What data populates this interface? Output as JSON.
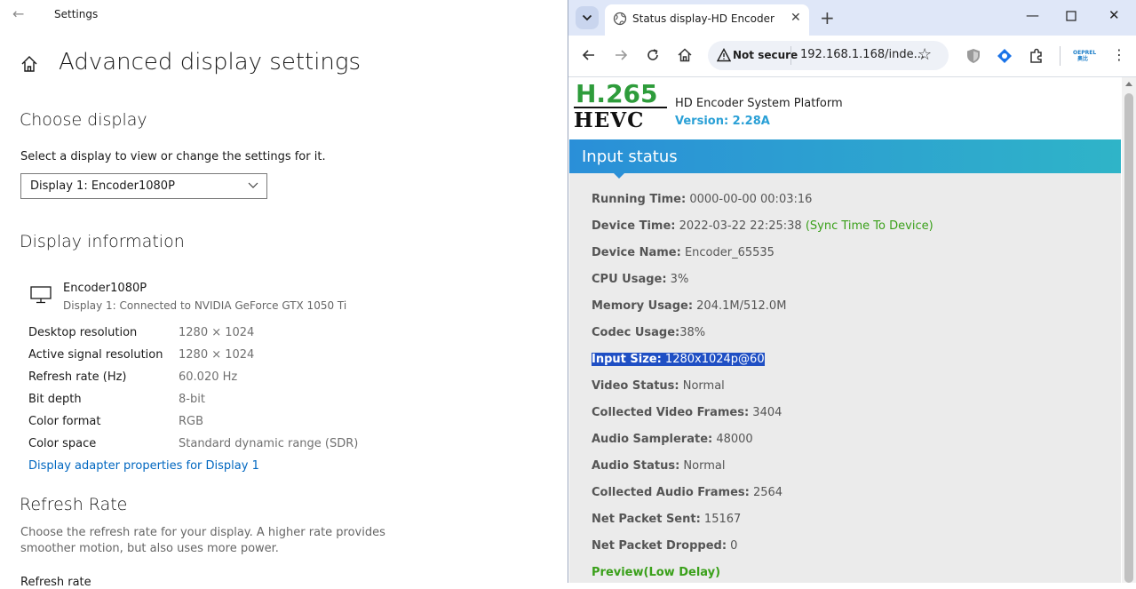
{
  "settings": {
    "app_title": "Settings",
    "page_title": "Advanced display settings",
    "choose_display": {
      "heading": "Choose display",
      "description": "Select a display to view or change the settings for it.",
      "selected": "Display 1: Encoder1080P"
    },
    "display_info": {
      "heading": "Display information",
      "device_name": "Encoder1080P",
      "device_sub": "Display 1: Connected to NVIDIA GeForce GTX 1050 Ti",
      "rows": [
        {
          "label": "Desktop resolution",
          "value": "1280 × 1024"
        },
        {
          "label": "Active signal resolution",
          "value": "1280 × 1024"
        },
        {
          "label": "Refresh rate (Hz)",
          "value": "60.020 Hz"
        },
        {
          "label": "Bit depth",
          "value": "8-bit"
        },
        {
          "label": "Color format",
          "value": "RGB"
        },
        {
          "label": "Color space",
          "value": "Standard dynamic range (SDR)"
        }
      ],
      "adapter_link": "Display adapter properties for Display 1"
    },
    "refresh_rate": {
      "heading": "Refresh Rate",
      "description": "Choose the refresh rate for your display. A higher rate provides smoother motion, but also uses more power.",
      "next_label": "Refresh rate"
    }
  },
  "browser": {
    "tab_title": "Status display-HD Encoder",
    "security_label": "Not secure",
    "url": "192.168.1.168/inde...",
    "extension_logo_text": "OEPREL 奥比",
    "accent_color": "#2a8fd8"
  },
  "encoder": {
    "logo_top": "H.265",
    "logo_bottom": "HEVC",
    "platform_name": "HD Encoder System Platform",
    "version": "Version: 2.28A",
    "section_title": "Input status",
    "rows": [
      {
        "label": "Running Time:",
        "value": " 0000-00-00 00:03:16"
      },
      {
        "label": "Device Time:",
        "value": " 2022-03-22 22:25:38 ",
        "extra": "(Sync Time To Device)"
      },
      {
        "label": "Device Name:",
        "value": " Encoder_65535"
      },
      {
        "label": "CPU Usage:",
        "value": " 3%"
      },
      {
        "label": "Memory Usage:",
        "value": " 204.1M/512.0M"
      },
      {
        "label": "Codec Usage:",
        "value": "38%"
      },
      {
        "label": "Input Size:",
        "value": " 1280x1024p@60"
      },
      {
        "label": "Video Status:",
        "value": " Normal"
      },
      {
        "label": "Collected Video Frames:",
        "value": " 3404"
      },
      {
        "label": "Audio Samplerate:",
        "value": " 48000"
      },
      {
        "label": "Audio Status:",
        "value": " Normal"
      },
      {
        "label": "Collected Audio Frames:",
        "value": " 2564"
      },
      {
        "label": "Net Packet Sent:",
        "value": " 15167"
      },
      {
        "label": "Net Packet Dropped:",
        "value": " 0"
      }
    ],
    "preview_link": "Preview(Low Delay)"
  }
}
